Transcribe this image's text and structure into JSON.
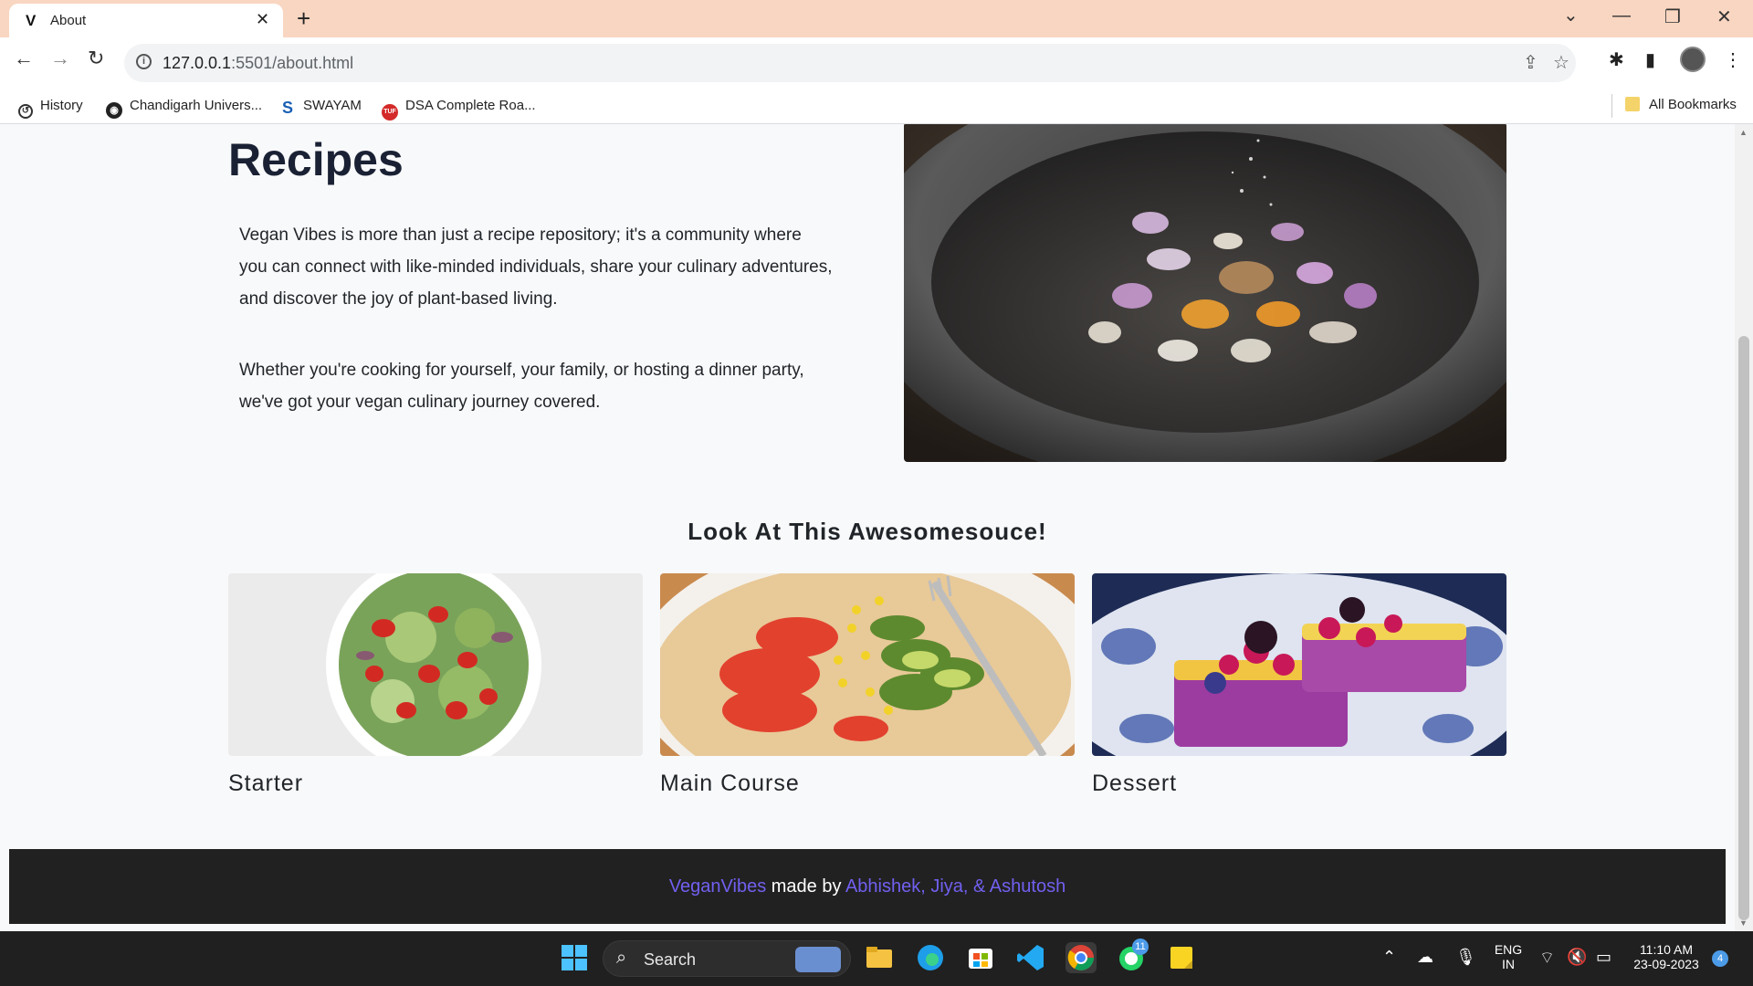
{
  "browser": {
    "tab": {
      "favicon": "V",
      "title": "About",
      "close": "✕"
    },
    "new_tab": "+",
    "window_controls": {
      "dropdown": "⌄",
      "minimize": "—",
      "restore": "❐",
      "close": "✕"
    },
    "url_host": "127.0.0.1",
    "url_rest": ":5501/about.html",
    "bookmarks": [
      {
        "label": "History",
        "icon": "history-icon"
      },
      {
        "label": "Chandigarh Univers...",
        "icon": "globe-icon"
      },
      {
        "label": "SWAYAM",
        "icon": "swayam-icon"
      },
      {
        "label": "DSA Complete Roa...",
        "icon": "tuf-icon"
      }
    ],
    "all_bookmarks": "All Bookmarks"
  },
  "hero": {
    "heading": "Recipes",
    "paragraphs": [
      "Vegan Vibes is more than just a recipe repository; it's a community where you can connect with like-minded individuals, share your culinary adventures, and discover the joy of plant-based living.",
      "Whether you're cooking for yourself, your family, or hosting a dinner party, we've got your vegan culinary journey covered."
    ]
  },
  "section": {
    "title": "Look At This Awesomesouce!",
    "cards": [
      {
        "label": "Starter"
      },
      {
        "label": "Main Course"
      },
      {
        "label": "Dessert"
      }
    ]
  },
  "footer": {
    "brand": "VeganVibes",
    "made_by": " made by ",
    "authors": "Abhishek, Jiya, & Ashutosh"
  },
  "taskbar": {
    "search_label": "Search",
    "lang_top": "ENG",
    "lang_bottom": "IN",
    "time": "11:10 AM",
    "date": "23-09-2023",
    "notification_count": "4",
    "whatsapp_badge": "11"
  },
  "colors": {
    "tab_strip": "#f9d6c1",
    "footer_bg": "#212121",
    "footer_link": "#7160f0",
    "heading": "#1a2134"
  }
}
